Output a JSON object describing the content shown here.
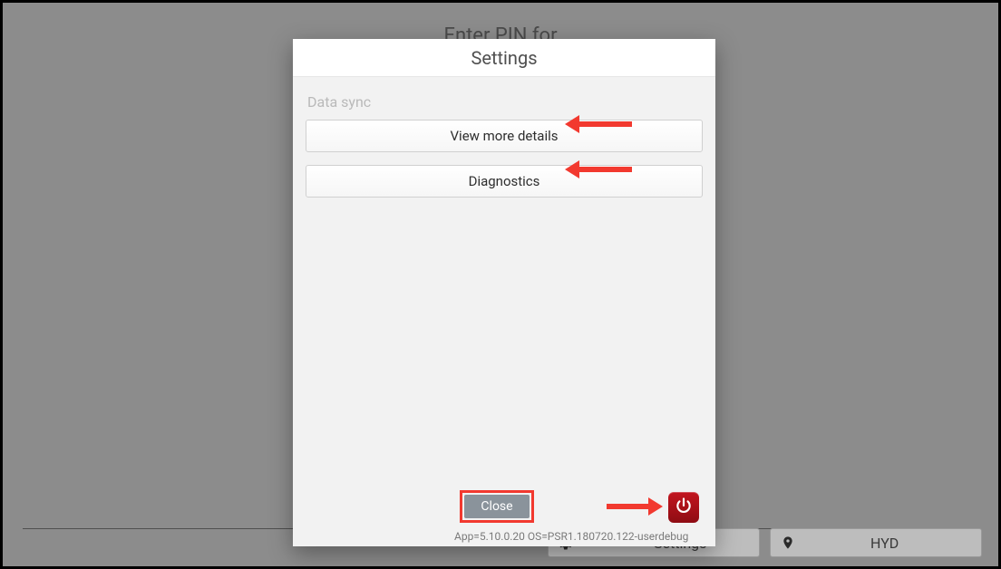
{
  "background": {
    "pin_prompt": "Enter PIN for"
  },
  "bottombar": {
    "settings_label": "Settings",
    "location_label": "HYD"
  },
  "dialog": {
    "title": "Settings",
    "section_label": "Data sync",
    "view_details_label": "View more details",
    "diagnostics_label": "Diagnostics",
    "close_label": "Close",
    "version_text": "App=5.10.0.20 OS=PSR1.180720.122-userdebug"
  }
}
